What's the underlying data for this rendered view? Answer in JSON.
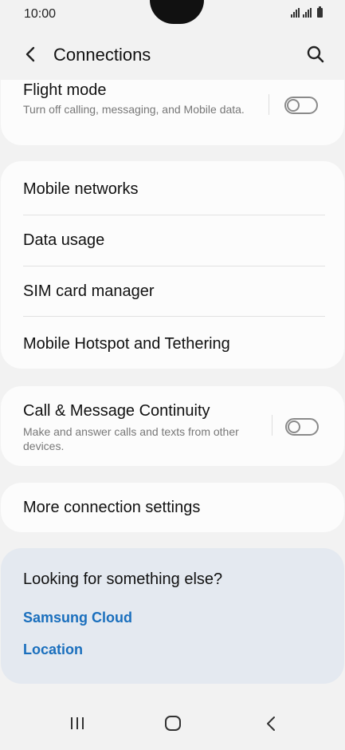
{
  "status_bar": {
    "time": "10:00"
  },
  "header": {
    "title": "Connections"
  },
  "airplane": {
    "title": "Flight mode",
    "subtitle": "Turn off calling, messaging, and Mobile data.",
    "enabled": false
  },
  "list": [
    {
      "label": "Mobile networks"
    },
    {
      "label": "Data usage"
    },
    {
      "label": "SIM card manager"
    },
    {
      "label": "Mobile Hotspot and Tethering"
    }
  ],
  "continuity": {
    "title": "Call & Message Continuity",
    "subtitle": "Make and answer calls and texts from other devices.",
    "enabled": false
  },
  "more": {
    "label": "More connection settings"
  },
  "suggestions": {
    "heading": "Looking for something else?",
    "links": [
      "Samsung Cloud",
      "Location"
    ]
  },
  "colors": {
    "link": "#1a6fbd",
    "background": "#f2f2f2",
    "card": "#fcfcfc",
    "suggestion_card": "#e4e9f0"
  },
  "icons": [
    "back-arrow-icon",
    "search-icon",
    "recent-apps-icon",
    "home-icon",
    "back-icon"
  ]
}
